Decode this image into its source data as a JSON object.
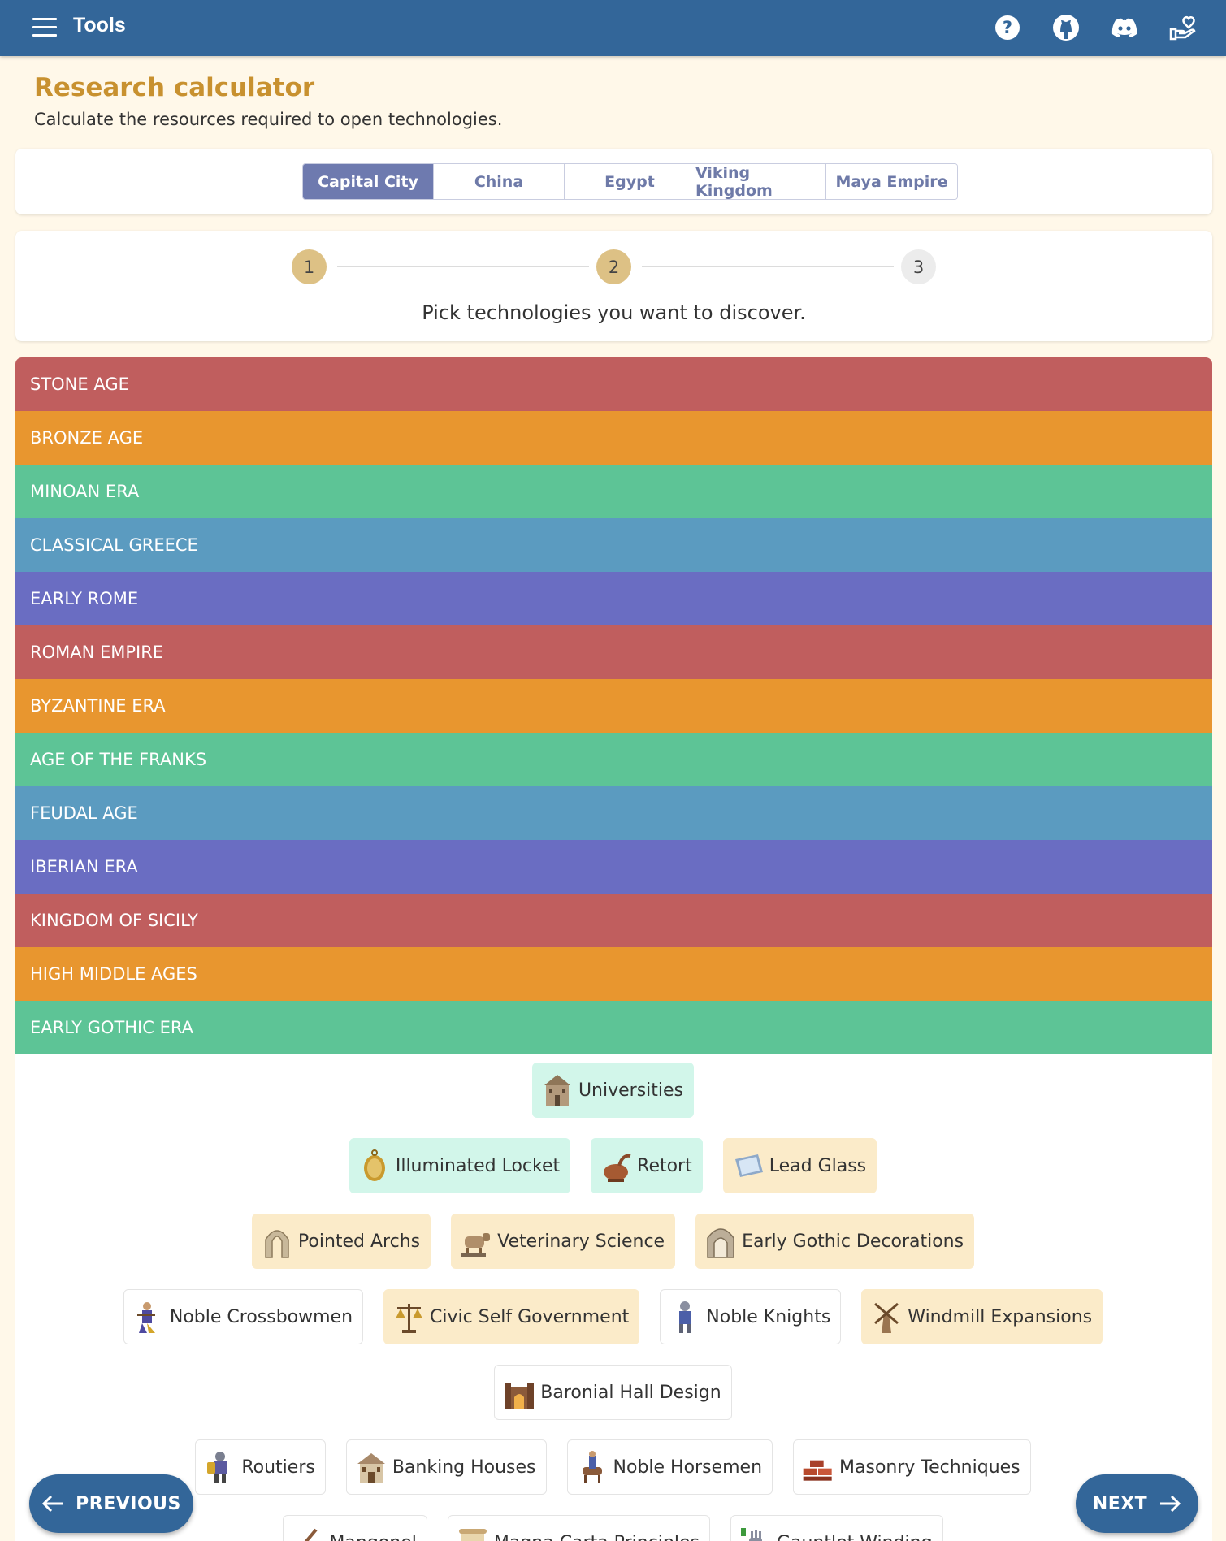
{
  "app": {
    "title": "Tools"
  },
  "header": {
    "title": "Research calculator",
    "subtitle": "Calculate the resources required to open technologies."
  },
  "tabs": [
    {
      "label": "Capital City",
      "active": true
    },
    {
      "label": "China"
    },
    {
      "label": "Egypt"
    },
    {
      "label": "Viking Kingdom"
    },
    {
      "label": "Maya Empire"
    }
  ],
  "stepper": {
    "steps": [
      "1",
      "2",
      "3"
    ],
    "current_step": 2,
    "caption": "Pick technologies you want to discover."
  },
  "eras": [
    {
      "label": "STONE AGE",
      "color": "#c05e5e"
    },
    {
      "label": "BRONZE AGE",
      "color": "#e8962f"
    },
    {
      "label": "MINOAN ERA",
      "color": "#5dc496"
    },
    {
      "label": "CLASSICAL GREECE",
      "color": "#5b9bc0"
    },
    {
      "label": "EARLY ROME",
      "color": "#6a6dc2"
    },
    {
      "label": "ROMAN EMPIRE",
      "color": "#c05e5e"
    },
    {
      "label": "BYZANTINE ERA",
      "color": "#e8962f"
    },
    {
      "label": "AGE OF THE FRANKS",
      "color": "#5dc496"
    },
    {
      "label": "FEUDAL AGE",
      "color": "#5b9bc0"
    },
    {
      "label": "IBERIAN ERA",
      "color": "#6a6dc2"
    },
    {
      "label": "KINGDOM OF SICILY",
      "color": "#c05e5e"
    },
    {
      "label": "HIGH MIDDLE AGES",
      "color": "#e8962f"
    },
    {
      "label": "EARLY GOTHIC ERA",
      "color": "#5dc496"
    }
  ],
  "technologies": [
    [
      {
        "label": "Universities",
        "icon": "university-icon",
        "state": "researched"
      }
    ],
    [
      {
        "label": "Illuminated Locket",
        "icon": "locket-icon",
        "state": "researched"
      },
      {
        "label": "Retort",
        "icon": "retort-icon",
        "state": "researched"
      },
      {
        "label": "Lead Glass",
        "icon": "glass-icon",
        "state": "selected"
      }
    ],
    [
      {
        "label": "Pointed Archs",
        "icon": "arch-icon",
        "state": "selected"
      },
      {
        "label": "Veterinary Science",
        "icon": "cow-icon",
        "state": "selected"
      },
      {
        "label": "Early Gothic Decorations",
        "icon": "gothic-icon",
        "state": "selected"
      }
    ],
    [
      {
        "label": "Noble Crossbowmen",
        "icon": "crossbowman-icon",
        "state": "none"
      },
      {
        "label": "Civic Self Government",
        "icon": "scales-icon",
        "state": "selected"
      },
      {
        "label": "Noble Knights",
        "icon": "knight-icon",
        "state": "none"
      },
      {
        "label": "Windmill Expansions",
        "icon": "windmill-icon",
        "state": "selected"
      }
    ],
    [
      {
        "label": "Baronial Hall Design",
        "icon": "hall-icon",
        "state": "none"
      }
    ],
    [
      {
        "label": "Routiers",
        "icon": "soldier-icon",
        "state": "none"
      },
      {
        "label": "Banking Houses",
        "icon": "bank-icon",
        "state": "none"
      },
      {
        "label": "Noble Horsemen",
        "icon": "horseman-icon",
        "state": "none"
      },
      {
        "label": "Masonry Techniques",
        "icon": "bricks-icon",
        "state": "none"
      }
    ],
    [
      {
        "label": "Mangonel",
        "icon": "catapult-icon",
        "state": "none"
      },
      {
        "label": "Magna Carta Principles",
        "icon": "scroll-icon",
        "state": "none"
      },
      {
        "label": "Gauntlet Winding",
        "icon": "gauntlet-icon",
        "state": "none"
      }
    ]
  ],
  "nav": {
    "previous_label": "PREVIOUS",
    "next_label": "NEXT"
  },
  "colors": {
    "primary": "#336699",
    "accent": "#c8912f",
    "tab_active": "#6e7aaf"
  }
}
